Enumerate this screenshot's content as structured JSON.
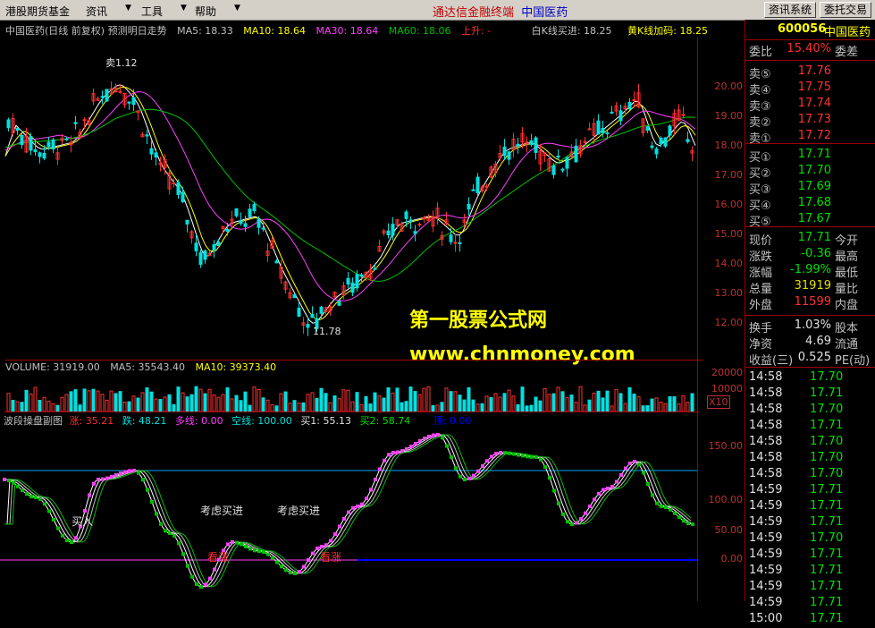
{
  "menu": {
    "items": [
      "港股期货基金",
      "资讯",
      "工具",
      "帮助"
    ],
    "center_title": "通达信金融终端",
    "center_stock": "中国医药",
    "btn_news": "资讯系统",
    "btn_trade": "委托交易"
  },
  "price_legend": {
    "name": "中国医药(日线 前复权) 预测明日走势",
    "ma5": "MA5: 18.33",
    "ma10": "MA10: 18.64",
    "ma30": "MA30: 18.64",
    "ma60": "MA60: 18.06",
    "up": "上升: -",
    "white_k": "白K线买进: 18.25",
    "yellow_k": "黄K线加码: 18.25"
  },
  "price_axis": [
    "20.00",
    "19.00",
    "18.00",
    "17.00",
    "16.00",
    "15.00",
    "14.00",
    "13.00",
    "12.00"
  ],
  "price_annotations": {
    "high": "1.12",
    "low": "11.78"
  },
  "volume_legend": {
    "label": "VOLUME: 31919.00",
    "ma5": "MA5: 35543.40",
    "ma10": "MA10: 39373.40"
  },
  "volume_axis": [
    "20000",
    "10000",
    "X10"
  ],
  "osc_legend": {
    "name": "波段操盘副图",
    "up": "涨: 35.21",
    "down": "跌: 48.21",
    "long": "多线: 0.00",
    "short": "空线: 100.00",
    "buy1": "买1: 55.13",
    "buy2": "买2: 58.74",
    "top": "顶: 0.00"
  },
  "osc_axis": [
    "150.00",
    "100.00",
    "50.00",
    "0.00"
  ],
  "osc_annotations": [
    "考虑买进",
    "考虑买进",
    "买入",
    "看涨",
    "看涨"
  ],
  "watermark": {
    "line1": "第一股票公式网",
    "line2": "www.chnmoney.com"
  },
  "quote": {
    "code": "600056",
    "name": "中国医药",
    "weibi_label": "委比",
    "weibi": "15.40%",
    "weicha_label": "委差",
    "asks": [
      {
        "label": "卖⑤",
        "price": "17.76"
      },
      {
        "label": "卖④",
        "price": "17.75"
      },
      {
        "label": "卖③",
        "price": "17.74"
      },
      {
        "label": "卖②",
        "price": "17.73"
      },
      {
        "label": "卖①",
        "price": "17.72"
      }
    ],
    "bids": [
      {
        "label": "买①",
        "price": "17.71"
      },
      {
        "label": "买②",
        "price": "17.70"
      },
      {
        "label": "买③",
        "price": "17.69"
      },
      {
        "label": "买④",
        "price": "17.68"
      },
      {
        "label": "买⑤",
        "price": "17.67"
      }
    ],
    "stats": [
      {
        "l": "现价",
        "v": "17.71",
        "r": "今开",
        "c": "#00e000"
      },
      {
        "l": "涨跌",
        "v": "-0.36",
        "r": "最高",
        "c": "#00e000"
      },
      {
        "l": "涨幅",
        "v": "-1.99%",
        "r": "最低",
        "c": "#00e000"
      },
      {
        "l": "总量",
        "v": "31919",
        "r": "量比",
        "c": "#e0e000"
      },
      {
        "l": "外盘",
        "v": "11599",
        "r": "内盘",
        "c": "#ff3030"
      }
    ],
    "stats2": [
      {
        "l": "换手",
        "v": "1.03%",
        "r": "股本"
      },
      {
        "l": "净资",
        "v": "4.69",
        "r": "流通"
      },
      {
        "l": "收益(三)",
        "v": "0.525",
        "r": "PE(动)"
      }
    ],
    "ticks": [
      {
        "t": "14:58",
        "p": "17.70"
      },
      {
        "t": "14:58",
        "p": "17.71"
      },
      {
        "t": "14:58",
        "p": "17.70"
      },
      {
        "t": "14:58",
        "p": "17.71"
      },
      {
        "t": "14:58",
        "p": "17.70"
      },
      {
        "t": "14:58",
        "p": "17.70"
      },
      {
        "t": "14:58",
        "p": "17.70"
      },
      {
        "t": "14:59",
        "p": "17.71"
      },
      {
        "t": "14:59",
        "p": "17.71"
      },
      {
        "t": "14:59",
        "p": "17.71"
      },
      {
        "t": "14:59",
        "p": "17.70"
      },
      {
        "t": "14:59",
        "p": "17.71"
      },
      {
        "t": "14:59",
        "p": "17.71"
      },
      {
        "t": "14:59",
        "p": "17.71"
      },
      {
        "t": "14:59",
        "p": "17.71"
      },
      {
        "t": "15:00",
        "p": "17.71"
      }
    ]
  },
  "colors": {
    "up": "#ff3030",
    "down": "#00e0e0",
    "ma5": "#ffffff",
    "ma10": "#ffff00",
    "ma30": "#ff40ff",
    "ma60": "#00c000"
  }
}
